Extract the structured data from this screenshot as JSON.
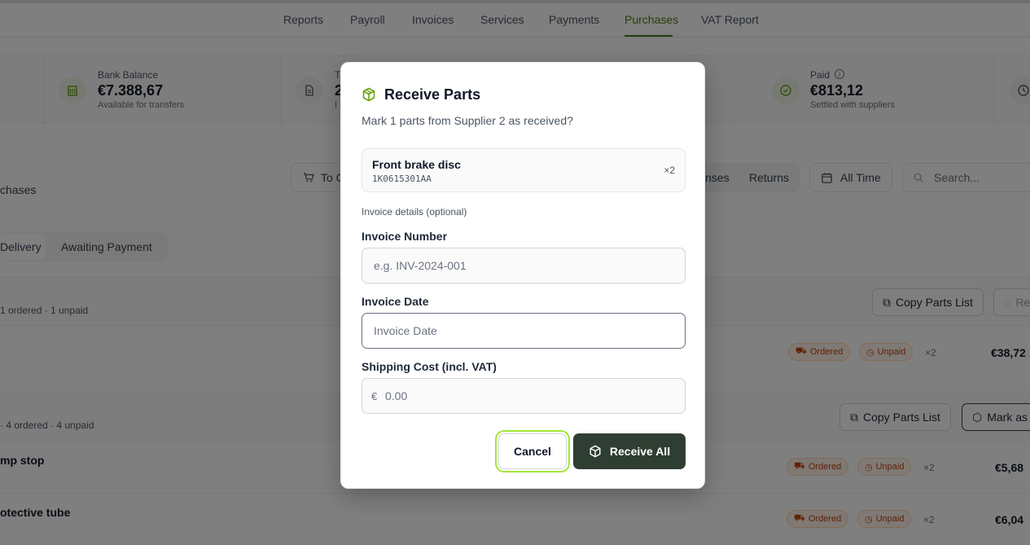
{
  "nav": {
    "tabs": [
      "Reports",
      "Payroll",
      "Invoices",
      "Services",
      "Payments",
      "Purchases",
      "VAT Report"
    ],
    "active": "Purchases"
  },
  "stats": {
    "bank": {
      "label": "Bank Balance",
      "value": "€7.388,67",
      "sub": "Available for transfers",
      "icon": "bank-icon"
    },
    "total": {
      "label": "T",
      "value": "2",
      "sub": "I",
      "icon": "document-icon"
    },
    "paid": {
      "label": "Paid",
      "value": "€813,12",
      "sub": "Settled with suppliers",
      "icon": "check-circle-icon"
    }
  },
  "filters": {
    "to_order": "To C",
    "expenses": "nses",
    "returns": "Returns",
    "period": "All Time",
    "search_placeholder": "Search..."
  },
  "page": {
    "heading": "chases",
    "status_tabs": [
      "Delivery",
      "Awaiting Payment"
    ]
  },
  "groups": [
    {
      "meta": "1 ordered · 1 unpaid",
      "actions": {
        "copy": "Copy Parts List",
        "receive": "Re"
      },
      "rows": [
        {
          "name": "",
          "status": "Ordered",
          "payment": "Unpaid",
          "qty": "×2",
          "price": "€38,72"
        }
      ]
    },
    {
      "meta": "· 4 ordered · 4 unpaid",
      "actions": {
        "copy": "Copy Parts List",
        "mark": "Mark as"
      },
      "rows": [
        {
          "name": "mp stop",
          "status": "Ordered",
          "payment": "Unpaid",
          "qty": "×2",
          "price": "€5,68"
        },
        {
          "name": "otective tube",
          "status": "Ordered",
          "payment": "Unpaid",
          "qty": "×2",
          "price": "€6,04"
        }
      ]
    }
  ],
  "modal": {
    "icon": "package-icon",
    "title": "Receive Parts",
    "description": "Mark 1 parts from Supplier 2 as received?",
    "part": {
      "name": "Front brake disc",
      "code": "1K0615301AA",
      "qty": "×2"
    },
    "section_label": "Invoice details (optional)",
    "invoice_number": {
      "label": "Invoice Number",
      "placeholder": "e.g. INV-2024-001",
      "value": ""
    },
    "invoice_date": {
      "label": "Invoice Date",
      "placeholder": "Invoice Date",
      "value": ""
    },
    "shipping": {
      "label": "Shipping Cost (incl. VAT)",
      "currency": "€",
      "placeholder": "0.00",
      "value": ""
    },
    "cancel": "Cancel",
    "confirm": "Receive All"
  },
  "colors": {
    "accent": "#4d7c0f",
    "primary_button": "#2f3e33",
    "focus_ring": "#a3e635",
    "ordered_badge": "#c2410c"
  }
}
